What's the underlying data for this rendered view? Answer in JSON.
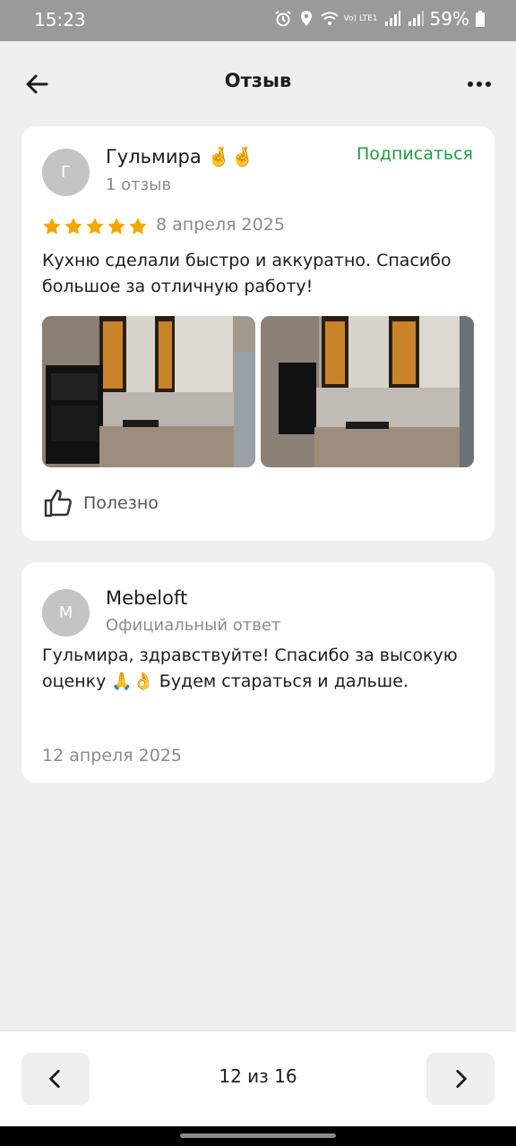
{
  "status_bar": {
    "time": "15:23",
    "battery": "59%",
    "network": "Vo) LTE1"
  },
  "header": {
    "title": "Отзыв"
  },
  "review": {
    "avatar_letter": "Г",
    "author": "Гульмира 🤞🤞",
    "reviews_count": "1 отзыв",
    "subscribe_label": "Подписаться",
    "rating": 5,
    "date": "8 апреля 2025",
    "text": "Кухню сделали быстро и аккуратно. Спасибо большое за отличную работу!",
    "useful_label": "Полезно"
  },
  "answer": {
    "avatar_letter": "M",
    "author": "Mebeloft",
    "subtitle": "Официальный ответ",
    "text": "Гульмира, здравствуйте! Спасибо за высокую оценку 🙏👌 Будем стараться и дальше.",
    "date": "12 апреля 2025"
  },
  "pager": {
    "counter": "12 из 16"
  },
  "colors": {
    "accent_green": "#1f9d3f",
    "star": "#f2a800",
    "background": "#efefef"
  },
  "icons": [
    "back-arrow-icon",
    "more-icon",
    "star-icon",
    "thumbs-up-icon",
    "chevron-left-icon",
    "chevron-right-icon"
  ]
}
